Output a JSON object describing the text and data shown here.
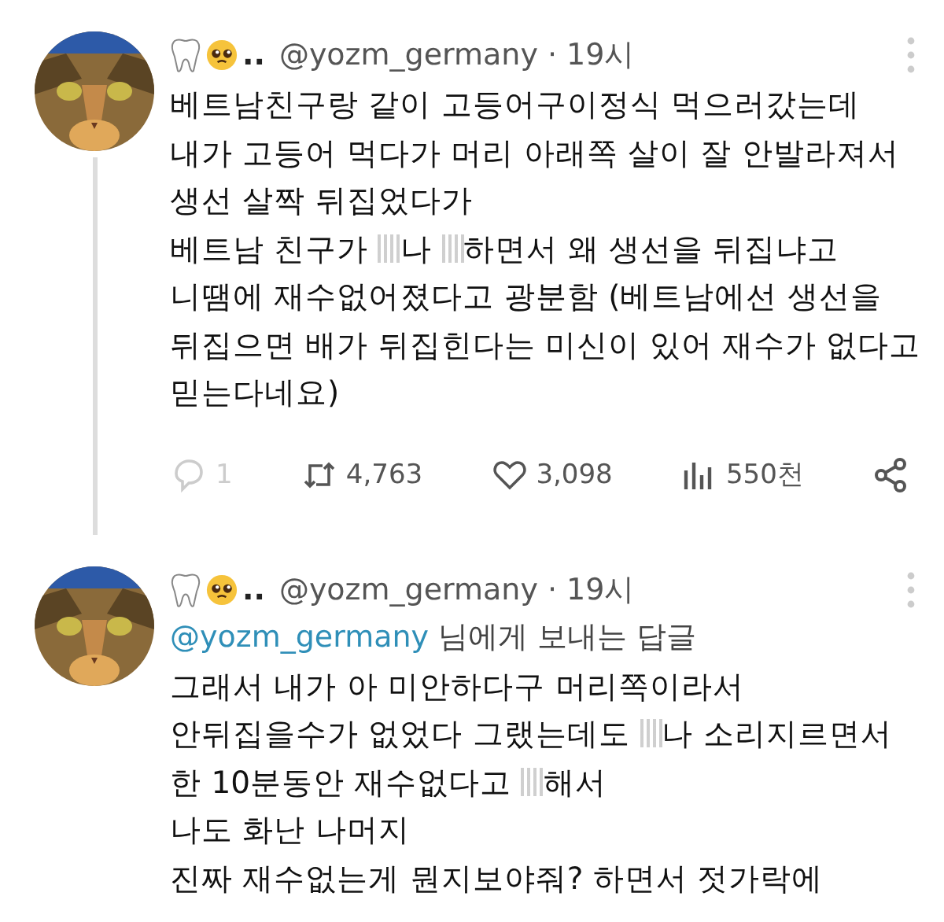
{
  "tweets": [
    {
      "handle": "@yozm_germany",
      "dots": "..",
      "separator": "·",
      "time": "19시",
      "lines": [
        [
          {
            "kind": "text",
            "text": "베트남친구랑 같이 고등어구이정식 먹으러갔는데"
          }
        ],
        [
          {
            "kind": "text",
            "text": "내가 고등어 먹다가 머리 아래쪽 살이 잘 안발라져서"
          }
        ],
        [
          {
            "kind": "text",
            "text": "생선 살짝 뒤집었다가"
          }
        ],
        [
          {
            "kind": "text",
            "text": "베트남 친구가 "
          },
          {
            "kind": "censored"
          },
          {
            "kind": "text",
            "text": "나 "
          },
          {
            "kind": "censored"
          },
          {
            "kind": "text",
            "text": "하면서 왜 생선을 뒤집냐고"
          }
        ],
        [
          {
            "kind": "text",
            "text": "니땜에 재수없어졌다고 광분함 (베트남에선 생선을"
          }
        ],
        [
          {
            "kind": "text",
            "text": "뒤집으면 배가 뒤집힌다는 미신이 있어 재수가 없다고"
          }
        ],
        [
          {
            "kind": "text",
            "text": "믿는다네요)"
          }
        ]
      ],
      "actions": {
        "replies": "1",
        "retweets": "4,763",
        "likes": "3,098",
        "views": "550천"
      }
    },
    {
      "handle": "@yozm_germany",
      "dots": "..",
      "separator": "·",
      "time": "19시",
      "reply_to": {
        "handle": "@yozm_germany",
        "text": "님에게 보내는 답글"
      },
      "lines": [
        [
          {
            "kind": "text",
            "text": "그래서 내가 아 미안하다구 머리쪽이라서"
          }
        ],
        [
          {
            "kind": "text",
            "text": "안뒤집을수가 없었다 그랬는데도 "
          },
          {
            "kind": "censored"
          },
          {
            "kind": "text",
            "text": "나 소리지르면서"
          }
        ],
        [
          {
            "kind": "text",
            "text": "한 10분동안 재수없다고 "
          },
          {
            "kind": "censored"
          },
          {
            "kind": "text",
            "text": "해서"
          }
        ],
        [
          {
            "kind": "text",
            "text": "나도 화난 나머지"
          }
        ],
        [
          {
            "kind": "text",
            "text": "진짜 재수없는게 뭔지보야줘? 하면서 젓가락에"
          }
        ]
      ]
    }
  ]
}
